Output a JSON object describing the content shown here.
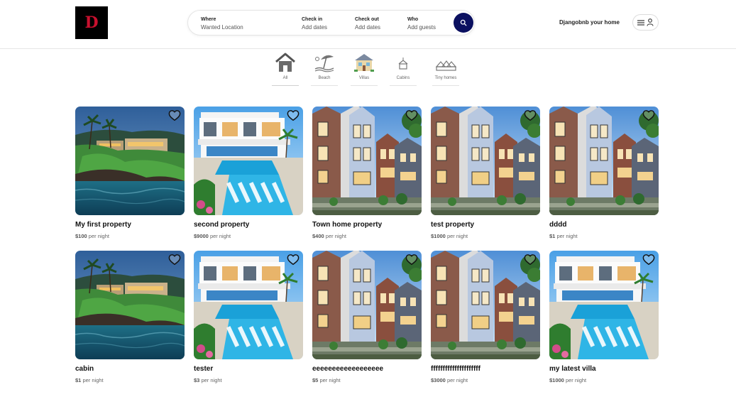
{
  "logo": {
    "letter": "D"
  },
  "search": {
    "where_label": "Where",
    "where_value": "Wanted Location",
    "checkin_label": "Check in",
    "checkin_value": "Add dates",
    "checkout_label": "Check out",
    "checkout_value": "Add dates",
    "who_label": "Who",
    "who_value": "Add guests"
  },
  "header": {
    "host_link": "Djangobnb your home"
  },
  "categories": [
    {
      "label": "All",
      "icon": "house-icon"
    },
    {
      "label": "Beach",
      "icon": "beach-umbrella-icon"
    },
    {
      "label": "Villas",
      "icon": "villa-icon"
    },
    {
      "label": "Cabins",
      "icon": "cabin-icon"
    },
    {
      "label": "Tiny homes",
      "icon": "tiny-homes-icon"
    }
  ],
  "price_suffix": "per night",
  "properties": [
    {
      "title": "My first property",
      "price": "$100",
      "image": "coastal-villa"
    },
    {
      "title": "second property",
      "price": "$9000",
      "image": "pool-villa"
    },
    {
      "title": "Town home property",
      "price": "$400",
      "image": "townhouse"
    },
    {
      "title": "test property",
      "price": "$1000",
      "image": "townhouse"
    },
    {
      "title": "dddd",
      "price": "$1",
      "image": "townhouse"
    },
    {
      "title": "cabin",
      "price": "$1",
      "image": "coastal-villa"
    },
    {
      "title": "tester",
      "price": "$3",
      "image": "pool-villa"
    },
    {
      "title": "eeeeeeeeeeeeeeeeee",
      "price": "$5",
      "image": "townhouse"
    },
    {
      "title": "fffffffffffffffffffff",
      "price": "$3000",
      "image": "townhouse"
    },
    {
      "title": "my latest villa",
      "price": "$1000",
      "image": "pool-villa"
    }
  ]
}
